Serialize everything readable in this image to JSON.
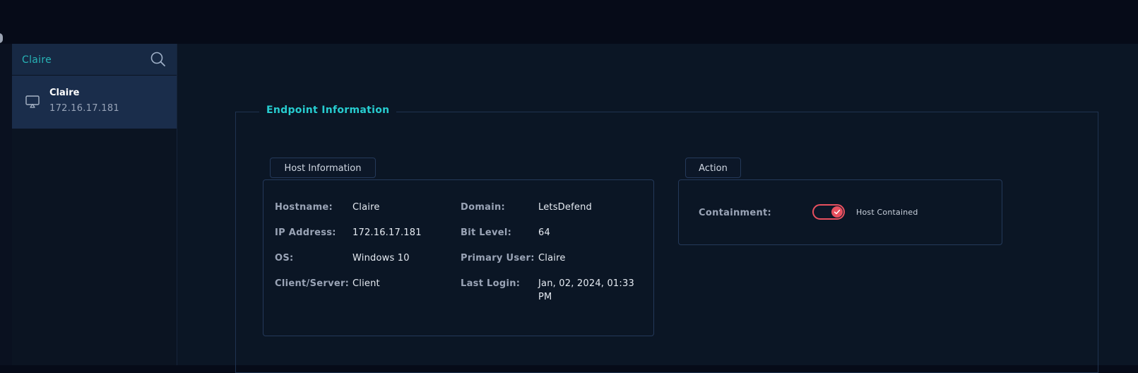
{
  "search": {
    "value": "Claire",
    "icon": "search-icon"
  },
  "host_list": [
    {
      "name": "Claire",
      "ip": "172.16.17.181",
      "icon": "monitor-icon"
    }
  ],
  "panel": {
    "title": "Endpoint Information"
  },
  "host_info": {
    "tab_label": "Host Information",
    "left": [
      {
        "label": "Hostname:",
        "value": "Claire"
      },
      {
        "label": "IP Address:",
        "value": "172.16.17.181"
      },
      {
        "label": "OS:",
        "value": "Windows 10"
      },
      {
        "label": "Client/Server:",
        "value": "Client"
      }
    ],
    "right": [
      {
        "label": "Domain:",
        "value": "LetsDefend"
      },
      {
        "label": "Bit Level:",
        "value": "64"
      },
      {
        "label": "Primary User:",
        "value": "Claire"
      },
      {
        "label": "Last Login:",
        "value": "Jan, 02, 2024, 01:33 PM"
      }
    ]
  },
  "action": {
    "tab_label": "Action",
    "containment_label": "Containment:",
    "toggle_state": "on",
    "toggle_text": "Host Contained",
    "toggle_color": "#e8505f"
  },
  "colors": {
    "accent": "#27cdd0",
    "background": "#060b18"
  }
}
